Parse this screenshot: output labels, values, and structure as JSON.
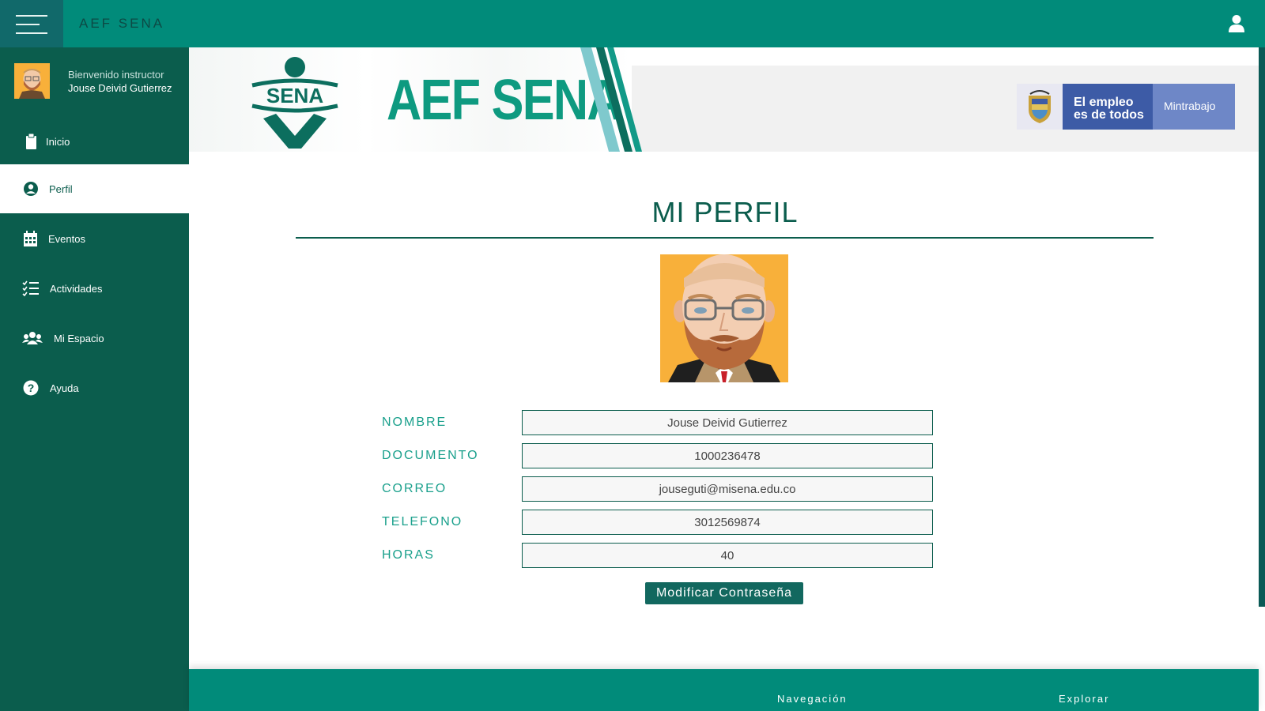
{
  "header": {
    "app_title": "AEF SENA",
    "menu_icon": "hamburger-menu-icon",
    "user_icon": "user-icon"
  },
  "sidebar": {
    "welcome": "Bienvenido instructor",
    "user_name": "Jouse Deivid Gutierrez",
    "items": [
      {
        "label": "Inicio",
        "icon": "clipboard-icon",
        "active": false
      },
      {
        "label": "Perfil",
        "icon": "user-circle-icon",
        "active": true
      },
      {
        "label": "Eventos",
        "icon": "calendar-icon",
        "active": false
      },
      {
        "label": "Actividades",
        "icon": "task-list-icon",
        "active": false
      },
      {
        "label": "Mi Espacio",
        "icon": "users-group-icon",
        "active": false
      },
      {
        "label": "Ayuda",
        "icon": "help-circle-icon",
        "active": false
      }
    ]
  },
  "banner": {
    "logo_text": "SENA",
    "brand": "AEF SENA",
    "gov_line1": "El empleo",
    "gov_line2": "es de todos",
    "gov_ministry": "Mintrabajo"
  },
  "main": {
    "title": "MI PERFIL",
    "fields": [
      {
        "label": "NOMBRE",
        "value": "Jouse Deivid Gutierrez"
      },
      {
        "label": "DOCUMENTO",
        "value": "1000236478"
      },
      {
        "label": "CORREO",
        "value": "jouseguti@misena.edu.co"
      },
      {
        "label": "TELEFONO",
        "value": "3012569874"
      },
      {
        "label": "HORAS",
        "value": "40"
      }
    ],
    "button_label": "Modificar Contraseña"
  },
  "footer": {
    "nav_label": "Navegación",
    "explore_label": "Explorar"
  },
  "colors": {
    "topbar": "#018b7a",
    "sidebar": "#0b5d4d",
    "accent_text": "#1aa08c",
    "button": "#12685f"
  }
}
